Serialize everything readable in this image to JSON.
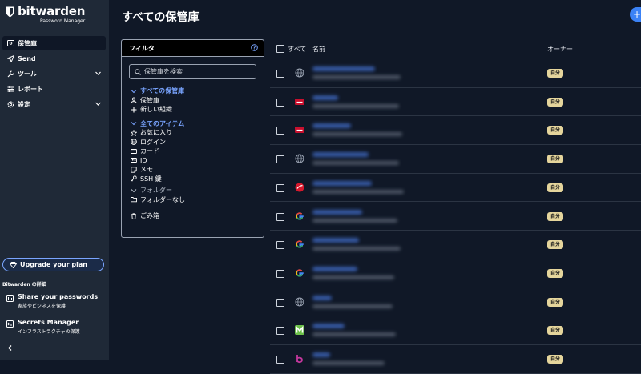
{
  "brand": {
    "name": "bitwarden",
    "subtitle": "Password Manager"
  },
  "sidebar": {
    "items": [
      {
        "label": "保管庫",
        "icon": "vault-icon",
        "active": true
      },
      {
        "label": "Send",
        "icon": "send-icon"
      },
      {
        "label": "ツール",
        "icon": "tools-icon",
        "expandable": true
      },
      {
        "label": "レポート",
        "icon": "reports-icon"
      },
      {
        "label": "設定",
        "icon": "gear-icon",
        "expandable": true
      }
    ],
    "upgrade_label": "Upgrade your plan",
    "more_title": "Bitwarden の詳細",
    "promos": [
      {
        "title": "Share your passwords",
        "subtitle": "家族やビジネスを保護"
      },
      {
        "title": "Secrets Manager",
        "subtitle": "インフラストラクチャの保護"
      }
    ]
  },
  "header": {
    "title": "すべての保管庫",
    "new_label": "+"
  },
  "filter": {
    "title": "フィルタ",
    "search_placeholder": "保管庫を検索",
    "vaults_heading": "すべての保管庫",
    "vaults": [
      "保管庫",
      "新しい組織"
    ],
    "items_heading": "全てのアイテム",
    "items": [
      "お気に入り",
      "ログイン",
      "カード",
      "ID",
      "メモ",
      "SSH 鍵"
    ],
    "folders_heading": "フォルダー",
    "folders": [
      "フォルダーなし"
    ],
    "trash": "ごみ箱"
  },
  "table": {
    "headers": {
      "all": "すべて",
      "name": "名前",
      "owner": "オーナー"
    },
    "rows": [
      {
        "icon": "globe-icon",
        "owner": "自分"
      },
      {
        "icon": "red-brand-icon",
        "owner": "自分"
      },
      {
        "icon": "red-brand-icon",
        "owner": "自分"
      },
      {
        "icon": "globe-icon",
        "owner": "自分"
      },
      {
        "icon": "red-circle-brand-icon",
        "owner": "自分"
      },
      {
        "icon": "google-icon",
        "owner": "自分"
      },
      {
        "icon": "google-icon",
        "owner": "自分"
      },
      {
        "icon": "google-icon",
        "owner": "自分"
      },
      {
        "icon": "globe-icon",
        "owner": "自分"
      },
      {
        "icon": "m-brand-icon",
        "owner": "自分"
      },
      {
        "icon": "b-brand-icon",
        "owner": "自分"
      }
    ]
  },
  "colors": {
    "accent": "#79a4ff",
    "sidebar": "#1f2937",
    "background": "#101827",
    "badge": "#e5d59c"
  }
}
